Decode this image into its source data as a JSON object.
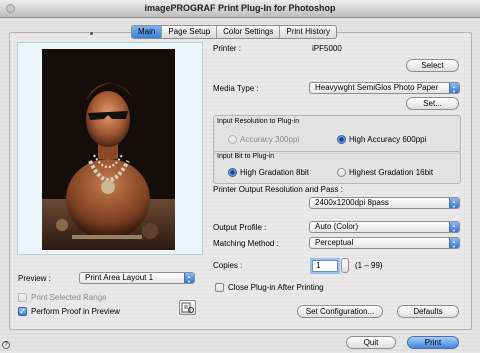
{
  "window": {
    "title": "imagePROGRAF Print Plug-In for Photoshop"
  },
  "tabs": [
    {
      "label": "Main",
      "active": true
    },
    {
      "label": "Page Setup",
      "active": false
    },
    {
      "label": "Color Settings",
      "active": false
    },
    {
      "label": "Print History",
      "active": false
    }
  ],
  "printer": {
    "label": "Printer :",
    "value": "iPF5000",
    "select_button": "Select"
  },
  "media": {
    "label": "Media Type :",
    "value": "Heavywght SemiGlos Photo Paper",
    "set_button": "Set..."
  },
  "input_resolution": {
    "title": "Input Resolution to Plug-in",
    "option1": "Accuracy 300ppi",
    "option2": "High Accuracy 600ppi",
    "selected": "High Accuracy 600ppi"
  },
  "input_bit": {
    "title": "Input Bit to Plug-in",
    "option1": "High Gradation 8bit",
    "option2": "Highest Gradation 16bit",
    "selected": "High Gradation 8bit"
  },
  "output_resolution": {
    "label": "Printer Output Resolution and Pass :",
    "value": "2400x1200dpi 8pass"
  },
  "output_profile": {
    "label": "Output Profile :",
    "value": "Auto (Color)"
  },
  "matching": {
    "label": "Matching Method :",
    "value": "Perceptual"
  },
  "copies": {
    "label": "Copies :",
    "value": "1",
    "range": "(1 – 99)"
  },
  "close_after_print": {
    "label": "Close Plug-in After Printing",
    "checked": false
  },
  "preview": {
    "label": "Preview :",
    "value": "Print Area Layout 1"
  },
  "print_selected_range": {
    "label": "Print Selected Range",
    "checked": false,
    "enabled": false
  },
  "proof_in_preview": {
    "label": "Perform Proof in Preview",
    "checked": true
  },
  "buttons": {
    "set_configuration": "Set Configuration...",
    "defaults": "Defaults",
    "quit": "Quit",
    "print": "Print"
  },
  "colors": {
    "accent": "#3f86df",
    "tab_active": "#5c98e3"
  }
}
